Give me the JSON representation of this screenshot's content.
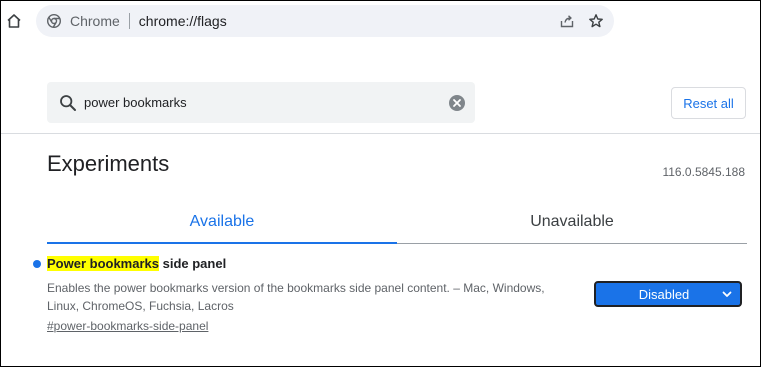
{
  "browser": {
    "site_label": "Chrome",
    "url": "chrome://flags"
  },
  "search": {
    "value": "power bookmarks",
    "placeholder": "Search flags"
  },
  "reset_label": "Reset all",
  "page": {
    "title": "Experiments",
    "version": "116.0.5845.188"
  },
  "tabs": [
    {
      "label": "Available",
      "active": true
    },
    {
      "label": "Unavailable",
      "active": false
    }
  ],
  "flag": {
    "name_highlight": "Power bookmarks",
    "name_rest": " side panel",
    "description": "Enables the power bookmarks version of the bookmarks side panel content. – Mac, Windows, Linux, ChromeOS, Fuchsia, Lacros",
    "link": "#power-bookmarks-side-panel",
    "selected_option": "Disabled"
  },
  "colors": {
    "accent": "#1a73e8",
    "highlight": "#ffff00",
    "omnibox_bg": "#f0f2f7"
  },
  "icons": [
    "home-icon",
    "chrome-logo-icon",
    "share-icon",
    "star-icon",
    "search-icon",
    "clear-icon",
    "chevron-down-icon"
  ]
}
